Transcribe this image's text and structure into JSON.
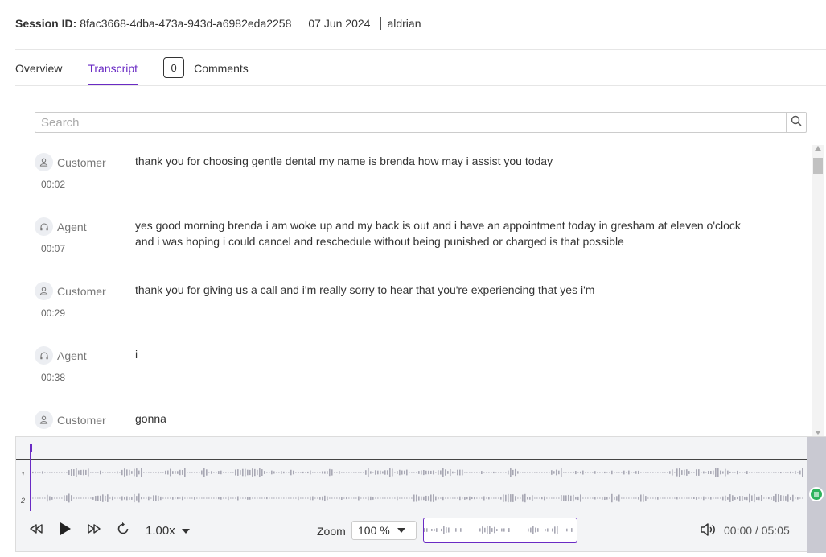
{
  "header": {
    "session_label": "Session ID:",
    "session_id": "8fac3668-4dba-473a-943d-a6982eda2258",
    "date": "07 Jun 2024",
    "user": "aldrian"
  },
  "tabs": {
    "overview": "Overview",
    "transcript": "Transcript",
    "comments_count": "0",
    "comments": "Comments",
    "active": "Transcript"
  },
  "search": {
    "placeholder": "Search",
    "value": ""
  },
  "transcript": [
    {
      "speaker": "Customer",
      "icon": "person-icon",
      "time": "00:02",
      "text": "thank you for choosing gentle dental my name is brenda how may i assist you today"
    },
    {
      "speaker": "Agent",
      "icon": "headset-icon",
      "time": "00:07",
      "text": "yes good morning brenda i am woke up and my back is out and i have an appointment today in gresham at eleven o'clock and i was hoping i could cancel and reschedule without being punished or charged is that possible"
    },
    {
      "speaker": "Customer",
      "icon": "person-icon",
      "time": "00:29",
      "text": "thank you for giving us a call and i'm really sorry to hear that you're experiencing that yes i'm"
    },
    {
      "speaker": "Agent",
      "icon": "headset-icon",
      "time": "00:38",
      "text": "i"
    },
    {
      "speaker": "Customer",
      "icon": "person-icon",
      "time": "",
      "text": "gonna"
    }
  ],
  "player": {
    "tracks": [
      "1",
      "2"
    ],
    "speed": "1.00x",
    "zoom_label": "Zoom",
    "zoom_value": "100 %",
    "current_time": "00:00",
    "duration": "05:05",
    "time_display": "00:00 / 05:05",
    "position_fraction": 0
  },
  "colors": {
    "accent": "#6a2bc4",
    "green": "#2fb35d",
    "wave": "#a8a8b4"
  }
}
